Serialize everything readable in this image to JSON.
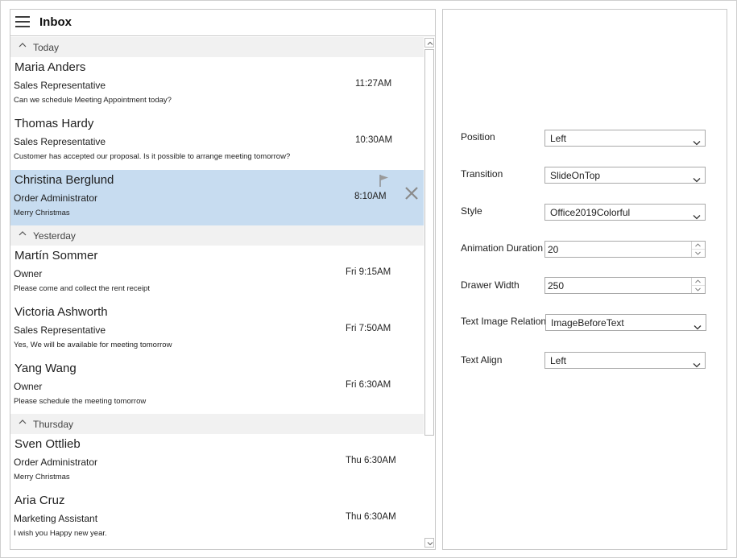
{
  "inbox": {
    "title": "Inbox",
    "groups": [
      {
        "label": "Today",
        "items": [
          {
            "name": "Maria Anders",
            "role": "Sales Representative",
            "message": "Can we schedule Meeting Appointment today?",
            "time": "11:27AM"
          },
          {
            "name": "Thomas Hardy",
            "role": "Sales Representative",
            "message": "Customer has accepted our proposal. Is it possible to arrange meeting tomorrow?",
            "time": "10:30AM"
          },
          {
            "name": "Christina Berglund",
            "role": "Order Administrator",
            "message": "Merry Christmas",
            "time": "8:10AM"
          }
        ]
      },
      {
        "label": "Yesterday",
        "items": [
          {
            "name": "Martín Sommer",
            "role": "Owner",
            "message": "Please come and collect the rent receipt",
            "time": "Fri 9:15AM"
          },
          {
            "name": "Victoria Ashworth",
            "role": "Sales Representative",
            "message": "Yes, We will be available for meeting tomorrow",
            "time": "Fri 7:50AM"
          },
          {
            "name": "Yang Wang",
            "role": "Owner",
            "message": "Please schedule the meeting tomorrow",
            "time": "Fri 6:30AM"
          }
        ]
      },
      {
        "label": "Thursday",
        "items": [
          {
            "name": "Sven Ottlieb",
            "role": "Order Administrator",
            "message": "Merry Christmas",
            "time": "Thu 6:30AM"
          },
          {
            "name": "Aria Cruz",
            "role": "Marketing Assistant",
            "message": "I wish you Happy new year.",
            "time": "Thu 6:30AM"
          }
        ]
      }
    ],
    "selected_item": "Christina Berglund",
    "selected_color": "#c7dcf0"
  },
  "options": {
    "position": {
      "label": "Position",
      "value": "Left"
    },
    "transition": {
      "label": "Transition",
      "value": "SlideOnTop"
    },
    "style": {
      "label": "Style",
      "value": "Office2019Colorful"
    },
    "animation_duration": {
      "label": "Animation Duration",
      "value": "20"
    },
    "drawer_width": {
      "label": "Drawer Width",
      "value": "250"
    },
    "text_image_relation": {
      "label": "Text Image Relation",
      "value": "ImageBeforeText"
    },
    "text_align": {
      "label": "Text Align",
      "value": "Left"
    }
  },
  "icons": {
    "menu": "hamburger-menu-icon",
    "group_toggle": "chevron-up-icon",
    "flag": "flag-icon",
    "delete": "close-icon",
    "dropdown": "chevron-down-icon"
  }
}
